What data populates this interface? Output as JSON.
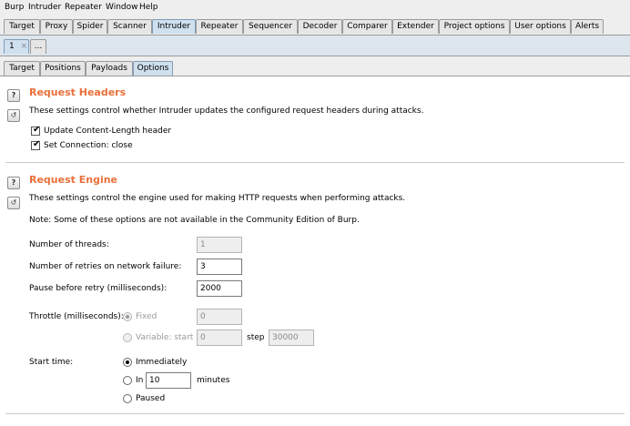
{
  "menu": [
    "Burp",
    "Intruder",
    "Repeater",
    "Window",
    "Help"
  ],
  "main_tabs": [
    "Target",
    "Proxy",
    "Spider",
    "Scanner",
    "Intruder",
    "Repeater",
    "Sequencer",
    "Decoder",
    "Comparer",
    "Extender",
    "Project options",
    "User options",
    "Alerts"
  ],
  "attack_tabs": {
    "current": "1",
    "close": "×",
    "more": "..."
  },
  "sub_tabs": [
    "Target",
    "Positions",
    "Payloads",
    "Options"
  ],
  "request_headers": {
    "title": "Request Headers",
    "description": "These settings control whether Intruder updates the configured request headers during attacks.",
    "update_content_length": "Update Content-Length header",
    "set_connection_close": "Set Connection: close"
  },
  "request_engine": {
    "title": "Request Engine",
    "description": "These settings control the engine used for making HTTP requests when performing attacks.",
    "note": "Note: Some of these options are not available in the Community Edition of Burp.",
    "threads_label": "Number of threads:",
    "threads_value": "1",
    "retries_label": "Number of retries on network failure:",
    "retries_value": "3",
    "pause_label": "Pause before retry (milliseconds):",
    "pause_value": "2000",
    "throttle_label": "Throttle (milliseconds):",
    "fixed_label": "Fixed",
    "fixed_value": "0",
    "variable_label": "Variable:  start",
    "variable_start": "0",
    "step_label": "step",
    "step_value": "30000",
    "start_time_label": "Start time:",
    "immediately_label": "Immediately",
    "in_label": "In",
    "in_value": "10",
    "minutes_label": "minutes",
    "paused_label": "Paused"
  },
  "help_icon": "question-mark",
  "reset_icon": "restore-defaults",
  "colors": {
    "section_title": "#e8703a",
    "selected_tab": "#cfe0ef"
  }
}
